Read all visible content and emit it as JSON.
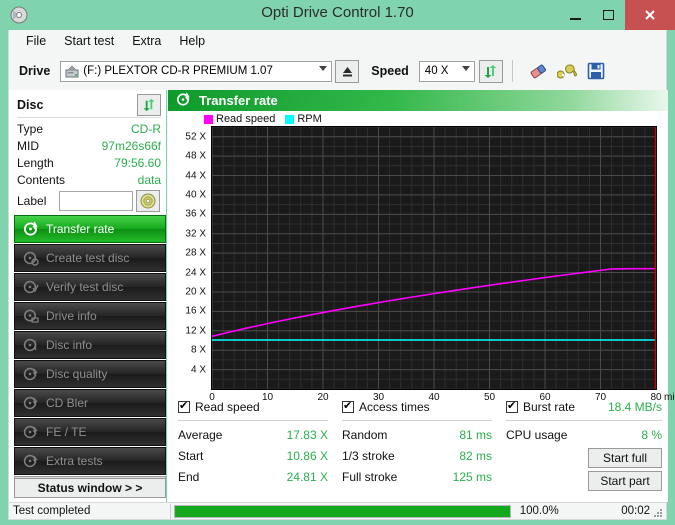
{
  "window": {
    "title": "Opti Drive Control 1.70",
    "app_icon": "disc-icon",
    "minimize": "–",
    "maximize": "□",
    "close": "✕"
  },
  "menubar": {
    "items": [
      "File",
      "Start test",
      "Extra",
      "Help"
    ]
  },
  "toolbar": {
    "drive_label": "Drive",
    "drive_value": "(F:)  PLEXTOR CD-R  PREMIUM 1.07",
    "eject_icon": "eject-icon",
    "speed_label": "Speed",
    "speed_value": "40 X",
    "refresh_icon": "refresh-icon",
    "erase_icon": "eraser-icon",
    "tools_icon": "wrench-icon",
    "save_icon": "save-icon"
  },
  "sidebar": {
    "disc_header": "Disc",
    "disc_refresh_icon": "refresh-icon",
    "disc_rows": [
      {
        "key": "Type",
        "value": "CD-R"
      },
      {
        "key": "MID",
        "value": "97m26s66f"
      },
      {
        "key": "Length",
        "value": "79:56.60"
      },
      {
        "key": "Contents",
        "value": "data"
      }
    ],
    "label_key": "Label",
    "label_value": "",
    "label_placeholder": "",
    "label_button_icon": "cd-disc-icon",
    "nav_items": [
      {
        "label": "Transfer rate",
        "icon": "disc-rate-icon",
        "active": true
      },
      {
        "label": "Create test disc",
        "icon": "disc-create-icon",
        "active": false
      },
      {
        "label": "Verify test disc",
        "icon": "disc-verify-icon",
        "active": false
      },
      {
        "label": "Drive info",
        "icon": "disc-drive-icon",
        "active": false
      },
      {
        "label": "Disc info",
        "icon": "disc-info-icon",
        "active": false
      },
      {
        "label": "Disc quality",
        "icon": "disc-quality-icon",
        "active": false
      },
      {
        "label": "CD Bler",
        "icon": "disc-bler-icon",
        "active": false
      },
      {
        "label": "FE / TE",
        "icon": "disc-fete-icon",
        "active": false
      },
      {
        "label": "Extra tests",
        "icon": "disc-extra-icon",
        "active": false
      }
    ],
    "status_window_button": "Status window > >"
  },
  "panel": {
    "title": "Transfer rate",
    "title_icon": "disc-rate-icon"
  },
  "stats": {
    "read_speed": {
      "checked": true,
      "label": "Read speed",
      "rows": [
        {
          "key": "Average",
          "value": "17.83 X"
        },
        {
          "key": "Start",
          "value": "10.86 X"
        },
        {
          "key": "End",
          "value": "24.81 X"
        }
      ]
    },
    "access_times": {
      "checked": true,
      "label": "Access times",
      "rows": [
        {
          "key": "Random",
          "value": "81 ms"
        },
        {
          "key": "1/3 stroke",
          "value": "82 ms"
        },
        {
          "key": "Full stroke",
          "value": "125 ms"
        }
      ]
    },
    "burst": {
      "checked": true,
      "label": "Burst rate",
      "value": "18.4 MB/s",
      "cpu_key": "CPU usage",
      "cpu_value": "8 %",
      "start_full": "Start full",
      "start_part": "Start part"
    }
  },
  "statusbar": {
    "text": "Test completed",
    "percent_label": "100.0%",
    "percent_value": 100,
    "elapsed": "00:02",
    "grip_icon": "resize-grip-icon"
  },
  "colors": {
    "accent_green": "#2bae4d",
    "title_bg": "#7fd4ae",
    "read_speed": "#FF00FF",
    "rpm": "#00FFFF",
    "end_marker": "#D00000",
    "plot_bg": "#1a1a1a",
    "grid": "#3a3a3a"
  },
  "chart_data": {
    "type": "line",
    "title": "Transfer rate",
    "xlabel": "min",
    "ylabel": "X",
    "xlim": [
      0,
      80
    ],
    "ylim": [
      0,
      54
    ],
    "grid": true,
    "legend_position": "top-left",
    "yticks": [
      4,
      8,
      12,
      16,
      20,
      24,
      28,
      32,
      36,
      40,
      44,
      48,
      52
    ],
    "ytick_labels": [
      "4 X",
      "8 X",
      "12 X",
      "16 X",
      "20 X",
      "24 X",
      "28 X",
      "32 X",
      "36 X",
      "40 X",
      "44 X",
      "48 X",
      "52 X"
    ],
    "xticks": [
      0,
      10,
      20,
      30,
      40,
      50,
      60,
      70,
      80
    ],
    "xtick_labels": [
      "0",
      "10",
      "20",
      "30",
      "40",
      "50",
      "60",
      "70",
      "80"
    ],
    "x_unit_label": "min",
    "end_marker_x": 79.9,
    "series": [
      {
        "name": "Read speed",
        "color": "#FF00FF",
        "x": [
          0,
          2,
          4,
          6,
          8,
          10,
          12,
          14,
          16,
          18,
          20,
          22,
          24,
          26,
          28,
          30,
          32,
          34,
          36,
          38,
          40,
          42,
          44,
          46,
          48,
          50,
          52,
          54,
          56,
          58,
          60,
          62,
          64,
          66,
          68,
          70,
          72,
          74,
          76,
          78,
          79.9
        ],
        "y": [
          10.86,
          11.42,
          11.96,
          12.48,
          12.99,
          13.48,
          13.96,
          14.43,
          14.88,
          15.33,
          15.76,
          16.19,
          16.6,
          17.01,
          17.41,
          17.8,
          18.19,
          18.57,
          18.94,
          19.3,
          19.66,
          20.01,
          20.36,
          20.7,
          21.04,
          21.37,
          21.7,
          22.02,
          22.34,
          22.65,
          22.96,
          23.27,
          23.57,
          23.87,
          24.16,
          24.45,
          24.74,
          24.78,
          24.79,
          24.8,
          24.81
        ]
      },
      {
        "name": "RPM",
        "color": "#00FFFF",
        "x": [
          0,
          79.9
        ],
        "y": [
          10.1,
          10.1
        ]
      }
    ]
  }
}
